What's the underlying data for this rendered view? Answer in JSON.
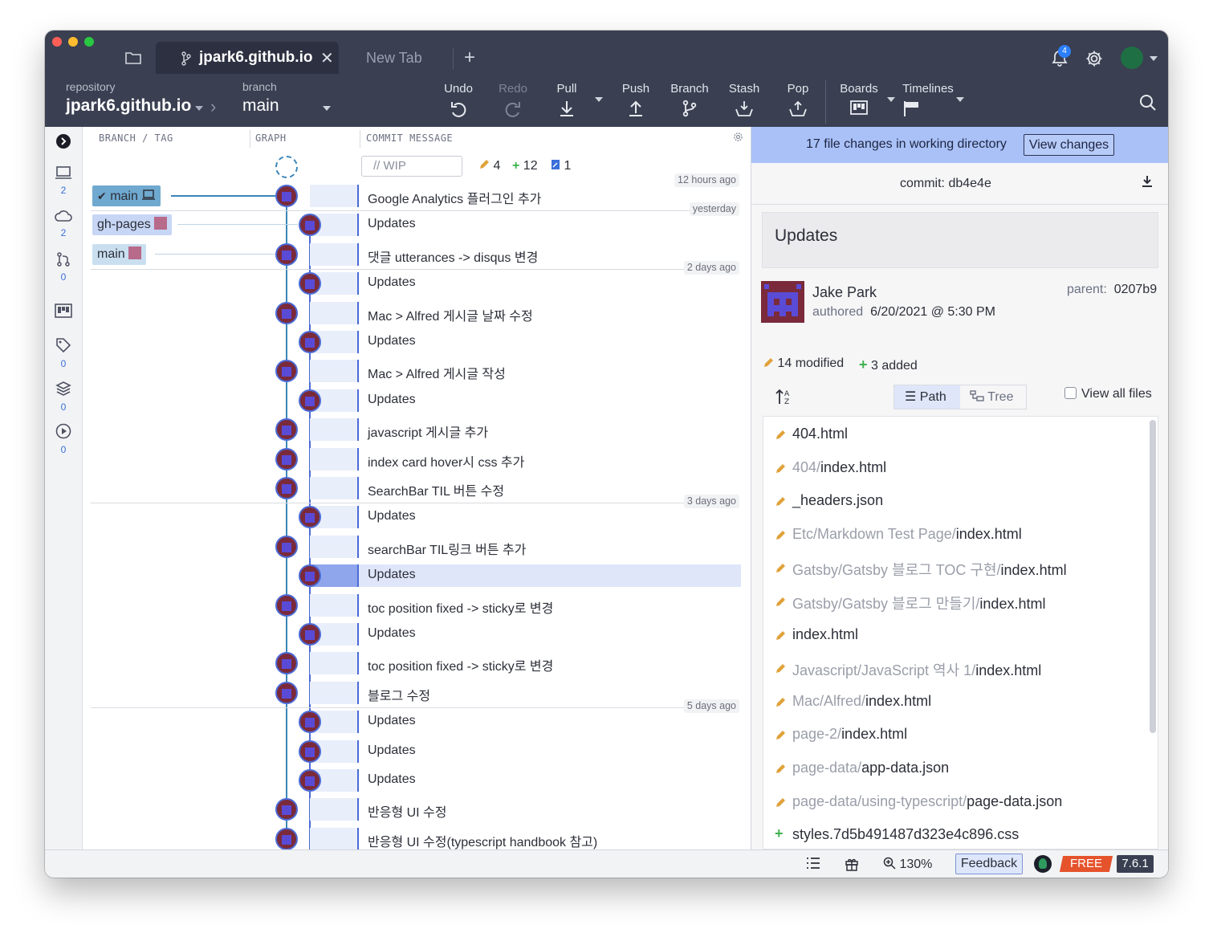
{
  "window": {
    "tabs": [
      {
        "label": "jpark6.github.io",
        "active": true
      },
      {
        "label": "New Tab",
        "active": false
      }
    ],
    "notifications_count": "4"
  },
  "toolbar": {
    "repository_label": "repository",
    "repository_value": "jpark6.github.io",
    "branch_label": "branch",
    "branch_value": "main",
    "buttons": [
      {
        "label": "Undo",
        "icon": "undo-icon",
        "enabled": true
      },
      {
        "label": "Redo",
        "icon": "redo-icon",
        "enabled": false
      },
      {
        "label": "Pull",
        "icon": "pull-icon",
        "enabled": true
      },
      {
        "label": "Push",
        "icon": "push-icon",
        "enabled": true
      },
      {
        "label": "Branch",
        "icon": "branch-icon",
        "enabled": true
      },
      {
        "label": "Stash",
        "icon": "stash-icon",
        "enabled": true
      },
      {
        "label": "Pop",
        "icon": "pop-icon",
        "enabled": true
      },
      {
        "label": "Boards",
        "icon": "boards-icon",
        "enabled": true
      },
      {
        "label": "Timelines",
        "icon": "timelines-icon",
        "enabled": true
      }
    ]
  },
  "rail": [
    {
      "icon": "local-icon",
      "count": "2"
    },
    {
      "icon": "remote-icon",
      "count": "2"
    },
    {
      "icon": "pull-requests-icon",
      "count": "0"
    },
    {
      "icon": "boards-icon",
      "count": ""
    },
    {
      "icon": "tag-icon",
      "count": "0"
    },
    {
      "icon": "stash-icon",
      "count": "0"
    },
    {
      "icon": "actions-icon",
      "count": "0"
    }
  ],
  "graph": {
    "headers": {
      "branch": "BRANCH / TAG",
      "graph": "GRAPH",
      "message": "COMMIT MESSAGE"
    },
    "wip": {
      "placeholder": "// WIP",
      "modified": "4",
      "added": "12",
      "renamed": "1"
    },
    "refs": [
      {
        "label": "main",
        "checked": true,
        "laptop": true
      },
      {
        "label": "gh-pages",
        "checked": false,
        "laptop": false
      },
      {
        "label": "main",
        "checked": false,
        "laptop": false
      }
    ],
    "date_labels": [
      {
        "label": "12 hours ago",
        "row": 0
      },
      {
        "label": "yesterday",
        "row": 1
      },
      {
        "label": "2 days ago",
        "row": 3
      },
      {
        "label": "3 days ago",
        "row": 11
      },
      {
        "label": "5 days ago",
        "row": 18
      }
    ],
    "commits": [
      {
        "message": "Google Analytics 플러그인 추가",
        "lane": 0,
        "selected": false
      },
      {
        "message": "Updates",
        "lane": 1,
        "selected": false
      },
      {
        "message": "댓글 utterances -> disqus 변경",
        "lane": 0,
        "selected": false
      },
      {
        "message": "Updates",
        "lane": 1,
        "selected": false
      },
      {
        "message": "Mac > Alfred 게시글 날짜 수정",
        "lane": 0,
        "selected": false
      },
      {
        "message": "Updates",
        "lane": 1,
        "selected": false
      },
      {
        "message": "Mac > Alfred 게시글 작성",
        "lane": 0,
        "selected": false
      },
      {
        "message": "Updates",
        "lane": 1,
        "selected": false
      },
      {
        "message": "javascript 게시글 추가",
        "lane": 0,
        "selected": false
      },
      {
        "message": "index card hover시 css 추가",
        "lane": 0,
        "selected": false
      },
      {
        "message": "SearchBar TIL 버튼 수정",
        "lane": 0,
        "selected": false
      },
      {
        "message": "Updates",
        "lane": 1,
        "selected": false
      },
      {
        "message": "searchBar TIL링크 버튼 추가",
        "lane": 0,
        "selected": false
      },
      {
        "message": "Updates",
        "lane": 1,
        "selected": true
      },
      {
        "message": "toc position fixed -> sticky로 변경",
        "lane": 0,
        "selected": false
      },
      {
        "message": "Updates",
        "lane": 1,
        "selected": false
      },
      {
        "message": "toc position fixed -> sticky로 변경",
        "lane": 0,
        "selected": false
      },
      {
        "message": "블로그 수정",
        "lane": 0,
        "selected": false
      },
      {
        "message": "Updates",
        "lane": 1,
        "selected": false
      },
      {
        "message": "Updates",
        "lane": 1,
        "selected": false
      },
      {
        "message": "Updates",
        "lane": 1,
        "selected": false
      },
      {
        "message": "반응형 UI 수정",
        "lane": 0,
        "selected": false
      },
      {
        "message": "반응형 UI 수정(typescript handbook 참고)",
        "lane": 0,
        "selected": false
      }
    ]
  },
  "detail": {
    "banner_text": "17 file changes in working directory",
    "view_changes_label": "View changes",
    "commit_label": "commit:",
    "commit_sha": "db4e4e",
    "summary": "Updates",
    "author": "Jake Park",
    "authored_label": "authored",
    "authored_date": "6/20/2021 @ 5:30 PM",
    "parent_label": "parent:",
    "parent_sha": "0207b9",
    "modified_text": "14 modified",
    "added_text": "3 added",
    "path_label": "Path",
    "tree_label": "Tree",
    "view_all_label": "View all files",
    "files": [
      {
        "dir": "",
        "name": "404.html",
        "status": "modified"
      },
      {
        "dir": "404/",
        "name": "index.html",
        "status": "modified"
      },
      {
        "dir": "",
        "name": "_headers.json",
        "status": "modified"
      },
      {
        "dir": "Etc/Markdown Test Page/",
        "name": "index.html",
        "status": "modified"
      },
      {
        "dir": "Gatsby/Gatsby 블로그 TOC 구현/",
        "name": "index.html",
        "status": "modified"
      },
      {
        "dir": "Gatsby/Gatsby 블로그 만들기/",
        "name": "index.html",
        "status": "modified"
      },
      {
        "dir": "",
        "name": "index.html",
        "status": "modified"
      },
      {
        "dir": "Javascript/JavaScript 역사 1/",
        "name": "index.html",
        "status": "modified"
      },
      {
        "dir": "Mac/Alfred/",
        "name": "index.html",
        "status": "modified"
      },
      {
        "dir": "page-2/",
        "name": "index.html",
        "status": "modified"
      },
      {
        "dir": "page-data/",
        "name": "app-data.json",
        "status": "modified"
      },
      {
        "dir": "page-data/using-typescript/",
        "name": "page-data.json",
        "status": "modified"
      },
      {
        "dir": "",
        "name": "styles.7d5b491487d323e4c896.css",
        "status": "added"
      }
    ]
  },
  "statusbar": {
    "zoom": "130%",
    "feedback_label": "Feedback",
    "plan_label": "FREE",
    "version": "7.6.1"
  },
  "colors": {
    "chrome": "#3a3f51",
    "lane_main": "#3b86b8",
    "lane_branch": "#4b6bd6",
    "selected_row": "#dfe6fa",
    "banner": "#a9c1f7",
    "modified": "#e0a23a",
    "added": "#3fb24f"
  }
}
